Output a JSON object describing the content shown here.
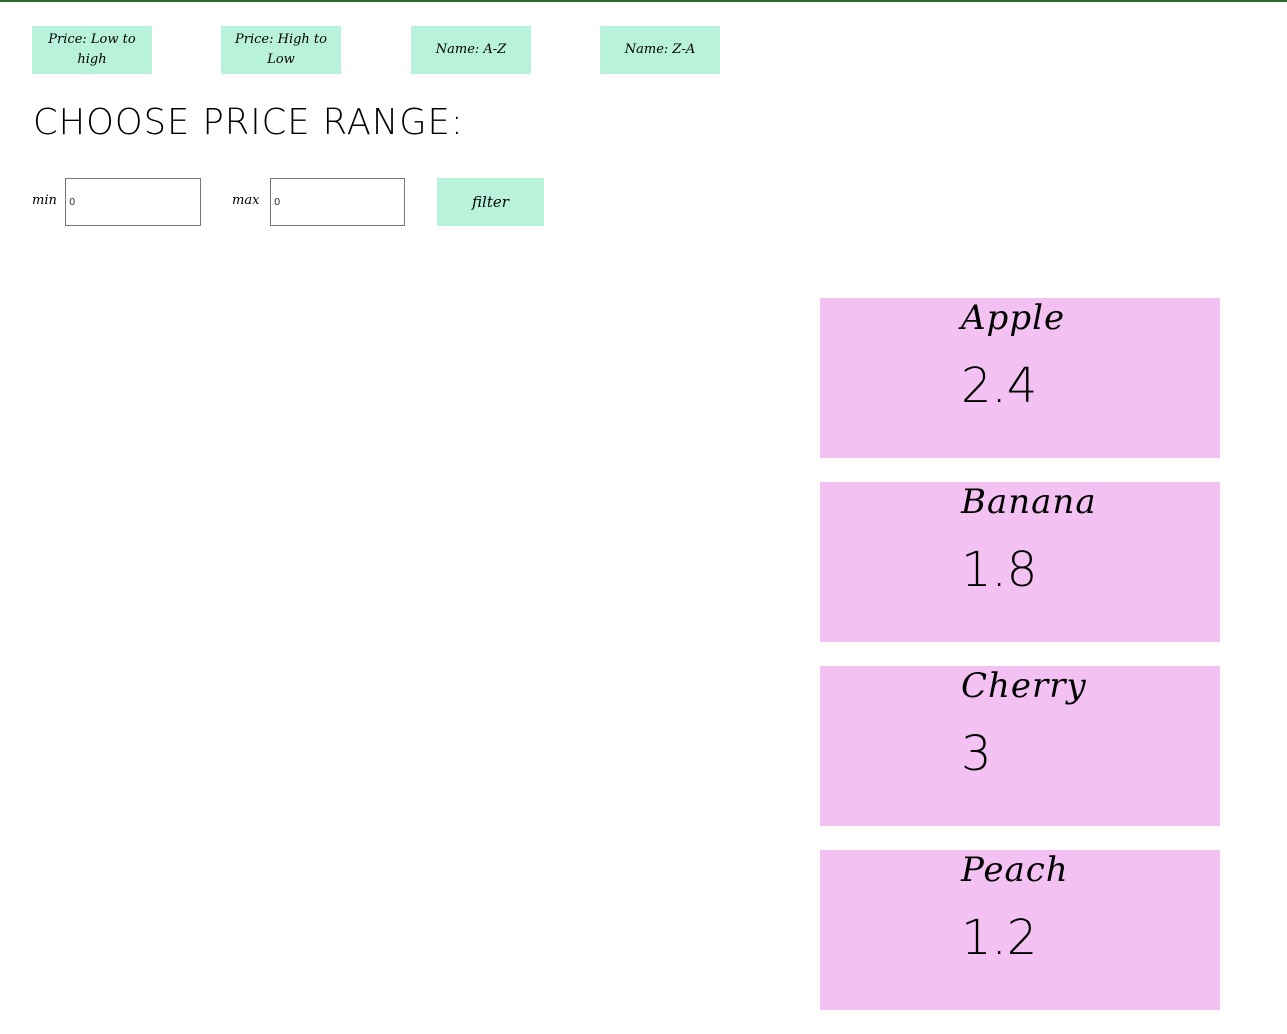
{
  "sort": {
    "price_low_high": "Price: Low to high",
    "price_high_low": "Price: High to Low",
    "name_a_z": "Name: A-Z",
    "name_z_a": "Name: Z-A"
  },
  "range": {
    "title": "CHOOSE PRICE RANGE:",
    "min_label": "min",
    "min_value": "0",
    "max_label": "max",
    "max_value": "0",
    "filter_label": "filter"
  },
  "products": [
    {
      "name": "Apple",
      "price": "2.4"
    },
    {
      "name": "Banana",
      "price": "1.8"
    },
    {
      "name": "Cherry",
      "price": "3"
    },
    {
      "name": "Peach",
      "price": "1.2"
    }
  ],
  "colors": {
    "button_bg": "#b8f2da",
    "card_bg": "#f3c2f3",
    "top_rule": "#2e6b2e"
  }
}
